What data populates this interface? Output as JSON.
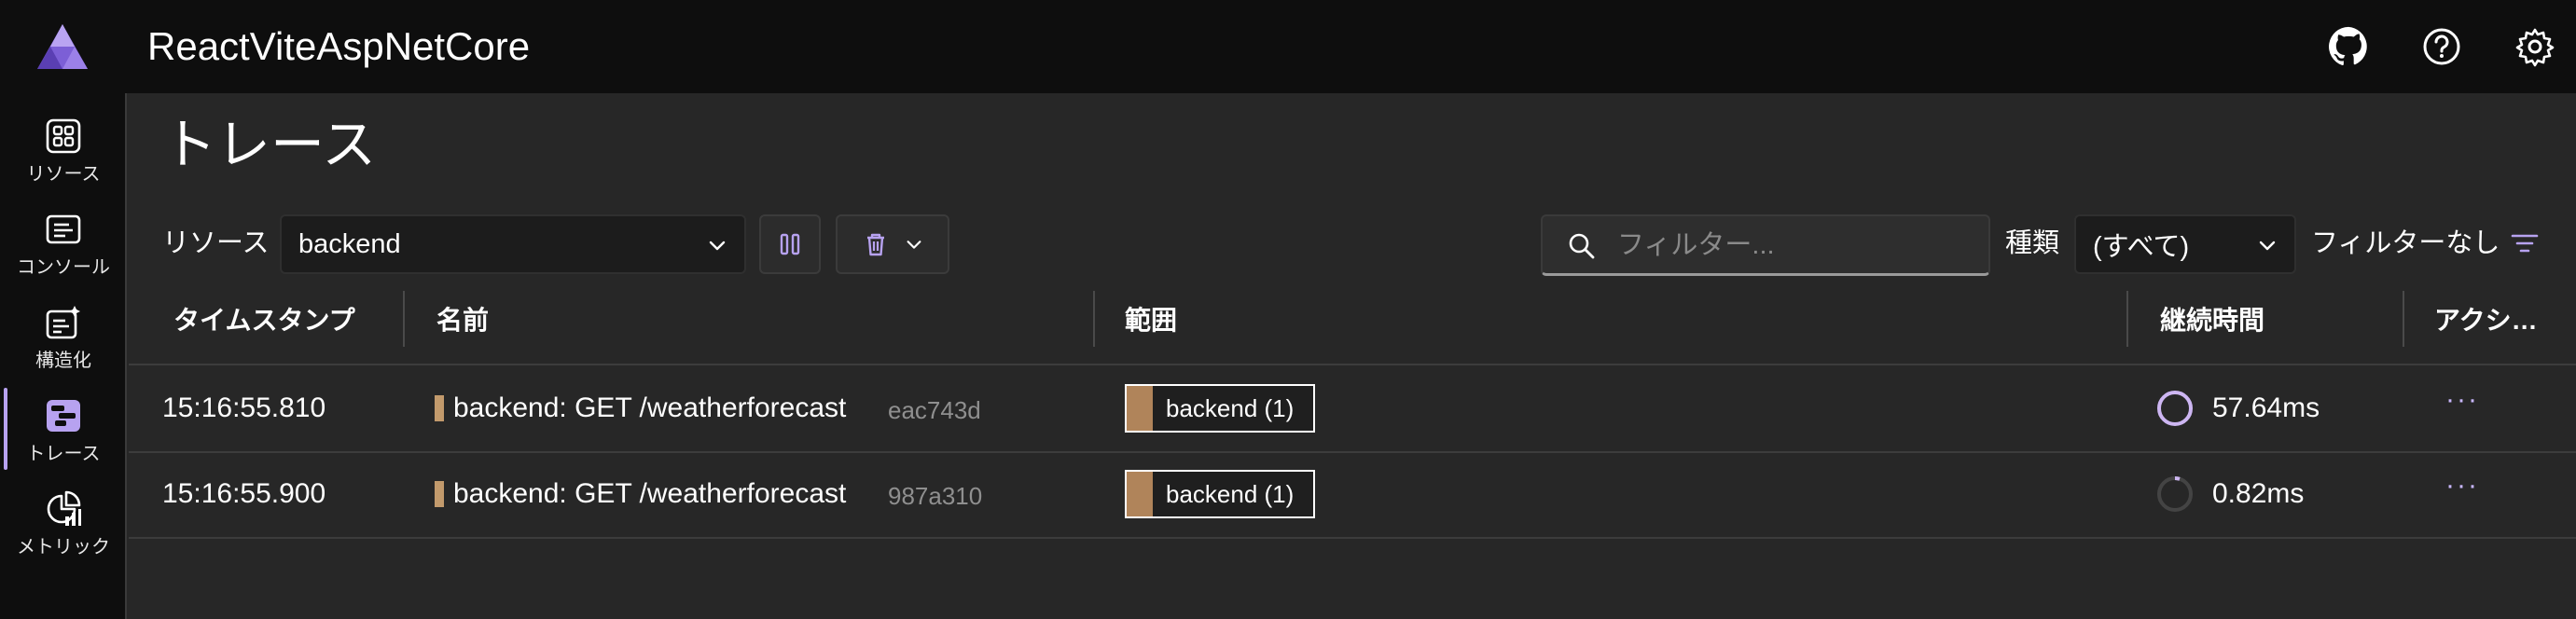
{
  "app": {
    "title": "ReactViteAspNetCore"
  },
  "colors": {
    "accent": "#b7a2f0",
    "span_fill": "#b0845a",
    "resource_bar": "#c29a6c"
  },
  "header_icons": [
    "github-icon",
    "help-icon",
    "settings-icon"
  ],
  "sidebar": {
    "items": [
      {
        "label": "リソース",
        "icon": "resources-icon",
        "active": false
      },
      {
        "label": "コンソール",
        "icon": "console-icon",
        "active": false
      },
      {
        "label": "構造化",
        "icon": "structured-icon",
        "active": false
      },
      {
        "label": "トレース",
        "icon": "traces-icon",
        "active": true
      },
      {
        "label": "メトリック",
        "icon": "metrics-icon",
        "active": false
      }
    ]
  },
  "page": {
    "title": "トレース"
  },
  "toolbar": {
    "resource_label": "リソース",
    "resource_value": "backend",
    "search_placeholder": "フィルター...",
    "type_label": "種類",
    "type_value": "(すべて)",
    "filter_status": "フィルターなし"
  },
  "table": {
    "columns": [
      "タイムスタンプ",
      "名前",
      "範囲",
      "継続時間",
      "アクシ…"
    ],
    "rows": [
      {
        "timestamp": "15:16:55.810",
        "name": "backend: GET /weatherforecast",
        "trace_id": "eac743d",
        "span": "backend (1)",
        "duration": "57.64ms",
        "duration_ring": "full"
      },
      {
        "timestamp": "15:16:55.900",
        "name": "backend: GET /weatherforecast",
        "trace_id": "987a310",
        "span": "backend (1)",
        "duration": "0.82ms",
        "duration_ring": "small"
      }
    ],
    "actions_glyph": "···"
  }
}
